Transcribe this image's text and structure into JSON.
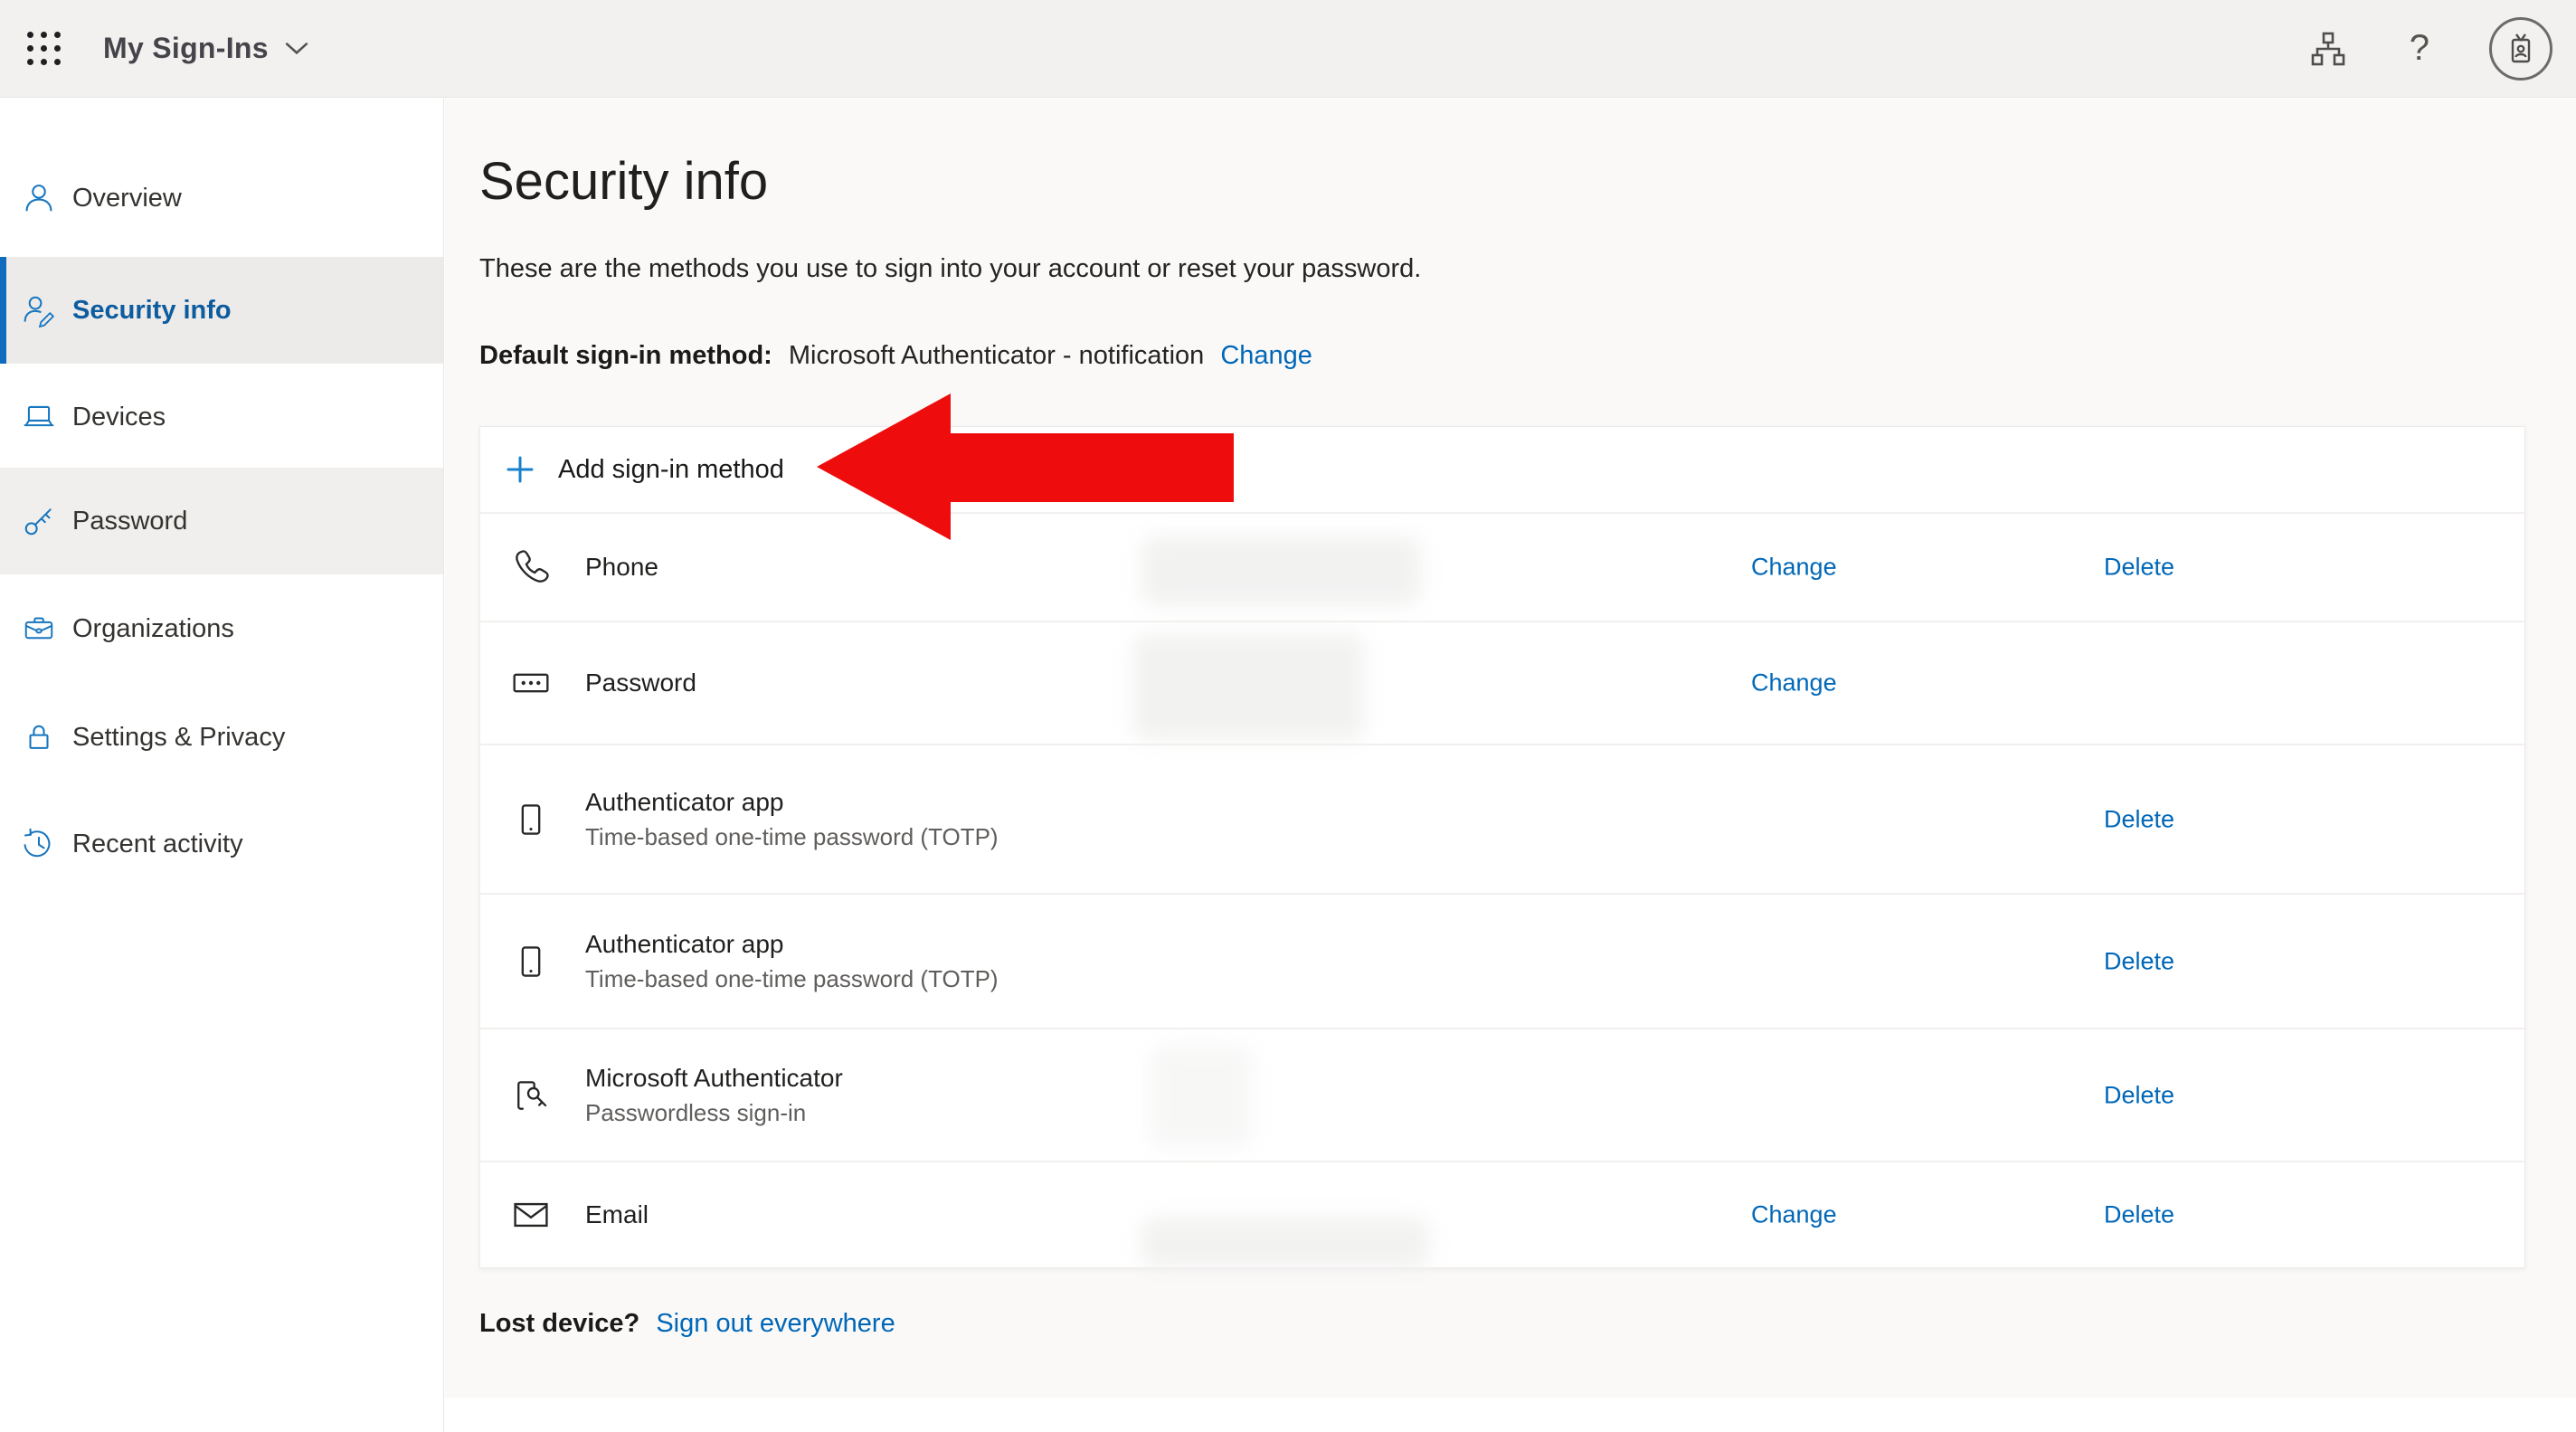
{
  "topbar": {
    "app_title": "My Sign-Ins",
    "help_label": "?"
  },
  "sidebar": {
    "items": [
      {
        "label": "Overview",
        "icon": "person-icon"
      },
      {
        "label": "Security info",
        "icon": "person-edit-icon",
        "selected": true
      },
      {
        "label": "Devices",
        "icon": "laptop-icon"
      },
      {
        "label": "Password",
        "icon": "key-icon"
      },
      {
        "label": "Organizations",
        "icon": "briefcase-icon"
      },
      {
        "label": "Settings & Privacy",
        "icon": "lock-icon"
      },
      {
        "label": "Recent activity",
        "icon": "history-icon"
      }
    ]
  },
  "main": {
    "title": "Security info",
    "subtitle": "These are the methods you use to sign into your account or reset your password.",
    "default_method": {
      "label": "Default sign-in method:",
      "value": "Microsoft Authenticator - notification",
      "change_label": "Change"
    },
    "add_button_label": "Add sign-in method",
    "methods": [
      {
        "icon": "phone-handset-icon",
        "name": "Phone",
        "change_label": "Change",
        "delete_label": "Delete"
      },
      {
        "icon": "password-field-icon",
        "name": "Password",
        "change_label": "Change"
      },
      {
        "icon": "smartphone-icon",
        "name": "Authenticator app",
        "subtitle": "Time-based one-time password (TOTP)",
        "delete_label": "Delete"
      },
      {
        "icon": "smartphone-icon",
        "name": "Authenticator app",
        "subtitle": "Time-based one-time password (TOTP)",
        "delete_label": "Delete"
      },
      {
        "icon": "phone-key-icon",
        "name": "Microsoft Authenticator",
        "subtitle": "Passwordless sign-in",
        "delete_label": "Delete"
      },
      {
        "icon": "envelope-icon",
        "name": "Email",
        "change_label": "Change",
        "delete_label": "Delete"
      }
    ],
    "lost_device": {
      "label": "Lost device?",
      "link_label": "Sign out everywhere"
    }
  },
  "colors": {
    "link": "#0067b8",
    "accent": "#0f6cbd",
    "selected_text": "#0d5c9f",
    "arrow": "#ee0c0c"
  }
}
